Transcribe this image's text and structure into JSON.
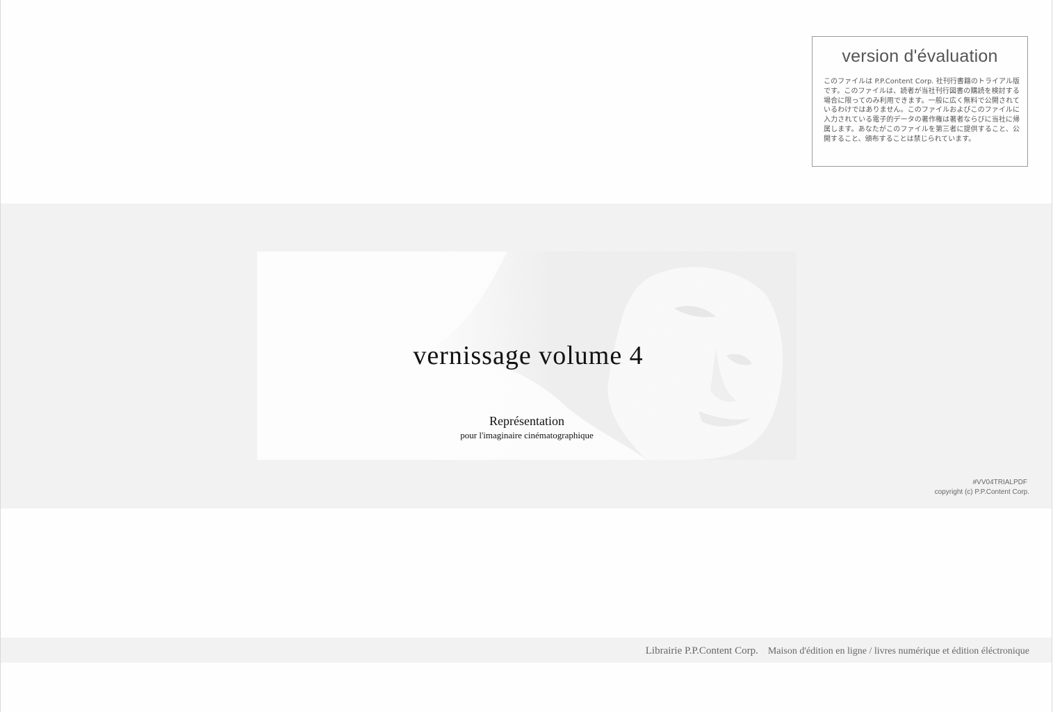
{
  "evaluation": {
    "title": "version d'évaluation",
    "notice": "このファイルは P.P.Content Corp. 社刊行書籍のトライアル版です。このファイルは、読者が当社刊行図書の購読を検討する場合に限ってのみ利用できます。一般に広く無料で公開されているわけではありません。このファイルおよびこのファイルに入力されている電子的データの著作権は著者ならびに当社に帰属します。あなたがこのファイルを第三者に提供すること、公開すること、頒布することは禁じられています。"
  },
  "cover": {
    "title": "vernissage volume 4",
    "subtitle": "Représentation",
    "subline": "pour l'imaginaire cinématographique"
  },
  "meta": {
    "code": "#VV04TRIALPDF",
    "copyright": "copyright (c) P.P.Content Corp."
  },
  "footer": {
    "publisher": "Librairie P.P.Content Corp.",
    "description": "Maison d'édition en ligne / livres numérique et édition éléctronique"
  },
  "colors": {
    "band": "#f2f2f2",
    "text_muted": "#666666",
    "photo_tone": "#ececec"
  }
}
